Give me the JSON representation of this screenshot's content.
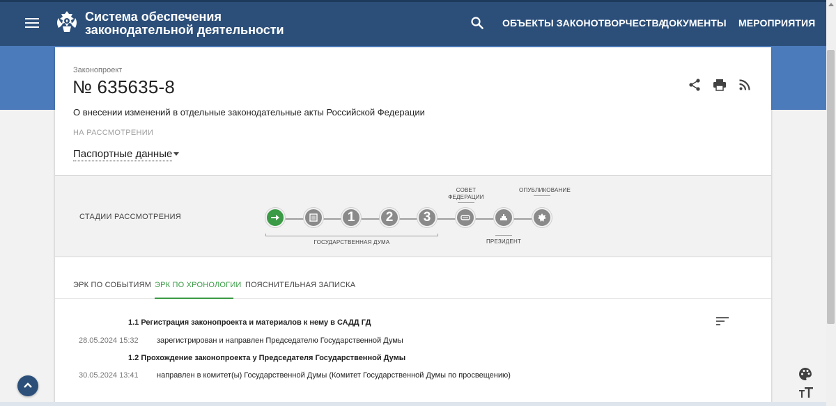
{
  "header": {
    "brand_line1": "Система обеспечения",
    "brand_line2": "законодательной деятельности",
    "nav": [
      "ОБЪЕКТЫ ЗАКОНОТВОРЧЕСТВА",
      "ДОКУМЕНТЫ",
      "МЕРОПРИЯТИЯ"
    ],
    "bg_color": "#2c4f7a"
  },
  "bill": {
    "type_label": "Законопроект",
    "number": "№ 635635-8",
    "title": "О внесении изменений в отдельные законодательные акты Российской Федерации",
    "status": "НА РАССМОТРЕНИИ",
    "passport_label": "Паспортные данные"
  },
  "stages": {
    "title": "СТАДИИ РАССМОТРЕНИЯ",
    "items": [
      {
        "icon": "arrow-right-icon",
        "active": true
      },
      {
        "icon": "document-list-icon",
        "active": false
      },
      {
        "label": "1",
        "active": false
      },
      {
        "label": "2",
        "active": false
      },
      {
        "label": "3",
        "active": false
      },
      {
        "icon": "federation-council-icon",
        "active": false
      },
      {
        "icon": "president-icon",
        "active": false
      },
      {
        "icon": "emblem-icon",
        "active": false
      }
    ],
    "group_duma": "ГОСУДАРСТВЕННАЯ ДУМА",
    "group_council_line1": "СОВЕТ",
    "group_council_line2": "ФЕДЕРАЦИИ",
    "group_president": "ПРЕЗИДЕНТ",
    "group_publication": "ОПУБЛИКОВАНИЕ",
    "accent_color": "#3a9a45"
  },
  "tabs": [
    {
      "label": "ЭРК ПО СОБЫТИЯМ",
      "active": false
    },
    {
      "label": "ЭРК ПО ХРОНОЛОГИИ",
      "active": true
    },
    {
      "label": "ПОЯСНИТЕЛЬНАЯ ЗАПИСКА",
      "active": false
    }
  ],
  "events": [
    {
      "heading": "1.1 Регистрация законопроекта и материалов к нему в САДД ГД",
      "date": "28.05.2024 15:32",
      "text": "зарегистрирован и направлен Председателю Государственной Думы"
    },
    {
      "heading": "1.2 Прохождение законопроекта у Председателя Государственной Думы",
      "date": "30.05.2024 13:41",
      "text": "направлен в комитет(ы) Государственной Думы (Комитет Государственной Думы по просвещению)"
    }
  ]
}
